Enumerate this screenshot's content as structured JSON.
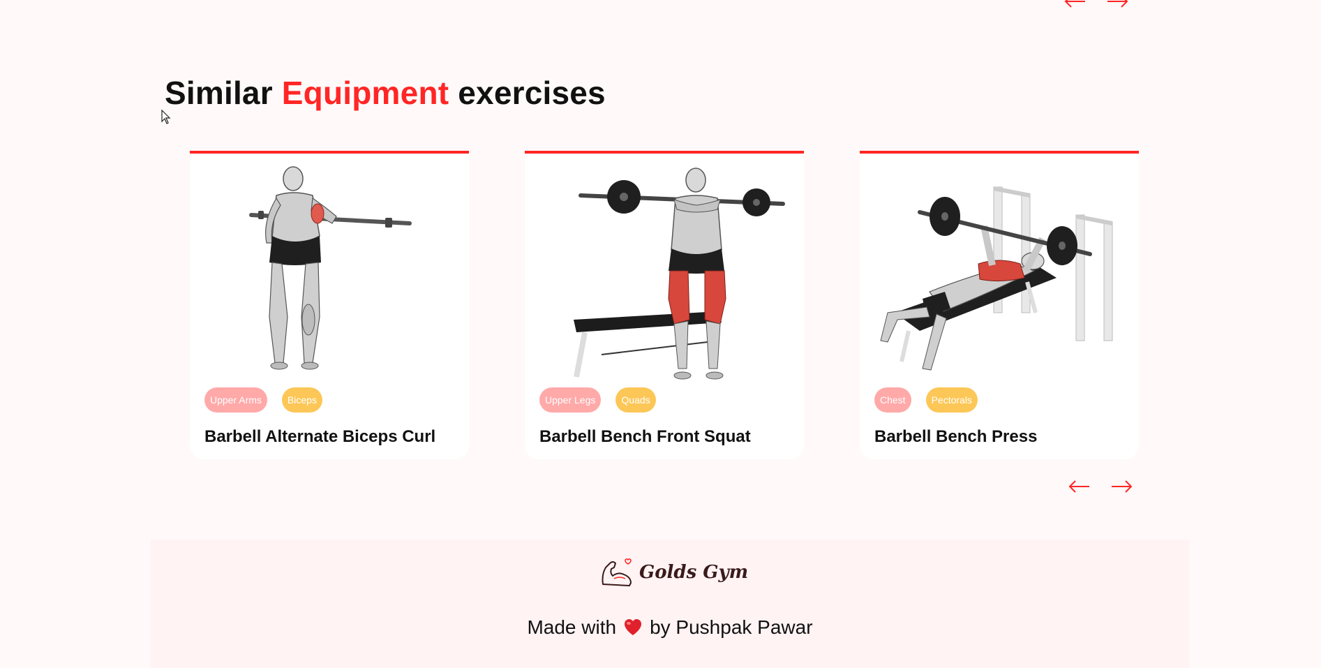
{
  "colors": {
    "accent": "#ff2625",
    "tag_body_part": "#ffa9a9",
    "tag_target": "#fcc757",
    "page_bg": "#fff9f9",
    "footer_bg": "#fff3f4"
  },
  "top_nav": {
    "prev_icon": "arrow-left-icon",
    "next_icon": "arrow-right-icon"
  },
  "section": {
    "title_part1": "Similar",
    "title_accent": "Equipment",
    "title_part2": "exercises"
  },
  "exercises": [
    {
      "body_part": "Upper Arms",
      "target": "Biceps",
      "name": "Barbell Alternate Biceps Curl",
      "illustration": "biceps-curl-illustration"
    },
    {
      "body_part": "Upper Legs",
      "target": "Quads",
      "name": "Barbell Bench Front Squat",
      "illustration": "front-squat-illustration"
    },
    {
      "body_part": "Chest",
      "target": "Pectorals",
      "name": "Barbell Bench Press",
      "illustration": "bench-press-illustration"
    }
  ],
  "bottom_nav": {
    "prev_icon": "arrow-left-icon",
    "next_icon": "arrow-right-icon"
  },
  "footer": {
    "logo_icon": "flexed-arm-heart-icon",
    "brand": "Golds Gym",
    "made_with": "Made with",
    "heart_icon": "heart-icon",
    "author": "by Pushpak Pawar"
  }
}
